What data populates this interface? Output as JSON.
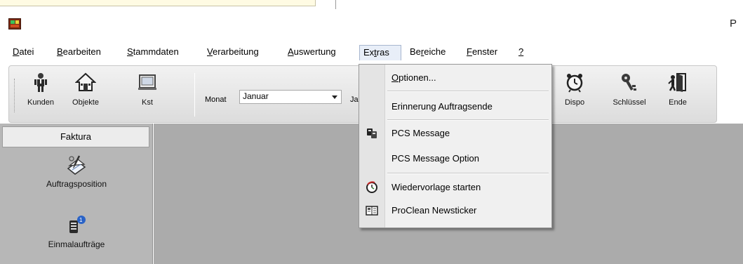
{
  "window": {
    "title_fragment": "P"
  },
  "menubar": {
    "items": [
      {
        "label": "Datei",
        "underline": "D",
        "rest": "atei"
      },
      {
        "label": "Bearbeiten",
        "underline": "B",
        "rest": "earbeiten"
      },
      {
        "label": "Stammdaten",
        "underline": "S",
        "rest": "tammdaten"
      },
      {
        "label": "Verarbeitung",
        "underline": "V",
        "rest": "erarbeitung"
      },
      {
        "label": "Auswertung",
        "underline": "A",
        "rest": "uswertung"
      },
      {
        "label": "Extras",
        "pre": "Ex",
        "underline": "t",
        "rest": "ras"
      },
      {
        "label": "Bereiche",
        "pre": "Be",
        "underline": "r",
        "rest": "eiche"
      },
      {
        "label": "Fenster",
        "underline": "F",
        "rest": "enster"
      },
      {
        "label": "?",
        "underline": "?",
        "rest": ""
      }
    ],
    "open_menu": "Extras"
  },
  "toolbar": {
    "buttons": [
      {
        "label": "Kunden",
        "icon": "person-icon"
      },
      {
        "label": "Objekte",
        "icon": "house-icon"
      },
      {
        "label": "Kst",
        "icon": "window-icon"
      },
      {
        "label": "Dispo",
        "icon": "alarm-clock-icon"
      },
      {
        "label": "Schlüssel",
        "icon": "keys-icon"
      },
      {
        "label": "Ende",
        "icon": "exit-door-icon"
      }
    ],
    "monat_label": "Monat",
    "monat_value": "Januar",
    "jahr_label": "Jahr"
  },
  "extras_menu": {
    "items": [
      {
        "label": "Optionen...",
        "underline": "O",
        "rest": "ptionen...",
        "icon": ""
      },
      {
        "label": "Erinnerung Auftragsende",
        "icon": ""
      },
      {
        "label": "PCS Message",
        "icon": "message-icon"
      },
      {
        "label": "PCS Message Option",
        "icon": ""
      },
      {
        "label": "Wiedervorlage starten",
        "icon": "resubmission-icon"
      },
      {
        "label": "ProClean Newsticker",
        "icon": "newsticker-icon"
      }
    ]
  },
  "sidepanel": {
    "header": "Faktura",
    "items": [
      {
        "label": "Auftragsposition",
        "icon": "order-position-icon"
      },
      {
        "label": "Einmalaufträge",
        "icon": "one-time-order-icon"
      }
    ]
  },
  "colors": {
    "workspace": "#ababab",
    "sidepanel": "#b7b7b7",
    "menu_bg": "#f0f0f0"
  }
}
